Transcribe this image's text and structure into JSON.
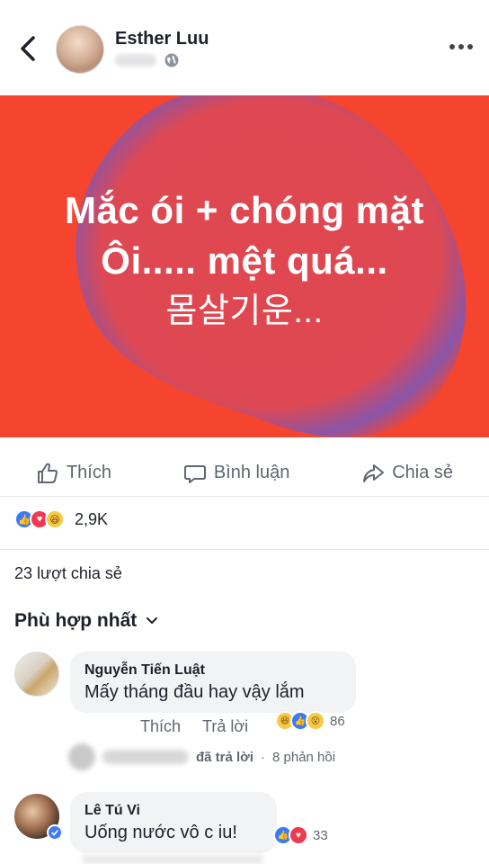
{
  "header": {
    "back_icon": "chevron-left-icon",
    "poster_name": "Esther Luu",
    "privacy_icon": "globe-icon",
    "more_icon": "more-horizontal-icon"
  },
  "post": {
    "background_color": "#f5452f",
    "blob_color": "#e0474f",
    "lines": [
      "Mắc ói + chóng mặt",
      "Ôi..... mệt quá...",
      "몸살기운..."
    ]
  },
  "actions": {
    "like_label": "Thích",
    "comment_label": "Bình luận",
    "share_label": "Chia sẻ"
  },
  "reactions": {
    "icons": [
      "like",
      "love",
      "haha"
    ],
    "count": "2,9K"
  },
  "shares": "23 lượt chia sẻ",
  "sort": {
    "label": "Phù hợp nhất"
  },
  "comments": [
    {
      "name": "Nguyễn Tiến Luật",
      "text": "Mấy tháng đầu hay vậy lắm",
      "like_label": "Thích",
      "reply_label": "Trả lời",
      "reaction_icons": [
        "haha",
        "like",
        "wow"
      ],
      "reaction_count": "86",
      "reply_summary": {
        "replied_text": "đã trả lời",
        "separator": "·",
        "count_text": "8 phản hồi"
      }
    },
    {
      "name": "Lê Tú Vi",
      "text": "Uống nước vô c iu!",
      "reaction_icons": [
        "like",
        "love"
      ],
      "reaction_count": "33"
    }
  ],
  "colors": {
    "like": "#3b7bf6",
    "love": "#f0394e",
    "haha": "#f7c944",
    "secondary_text": "#606770"
  }
}
